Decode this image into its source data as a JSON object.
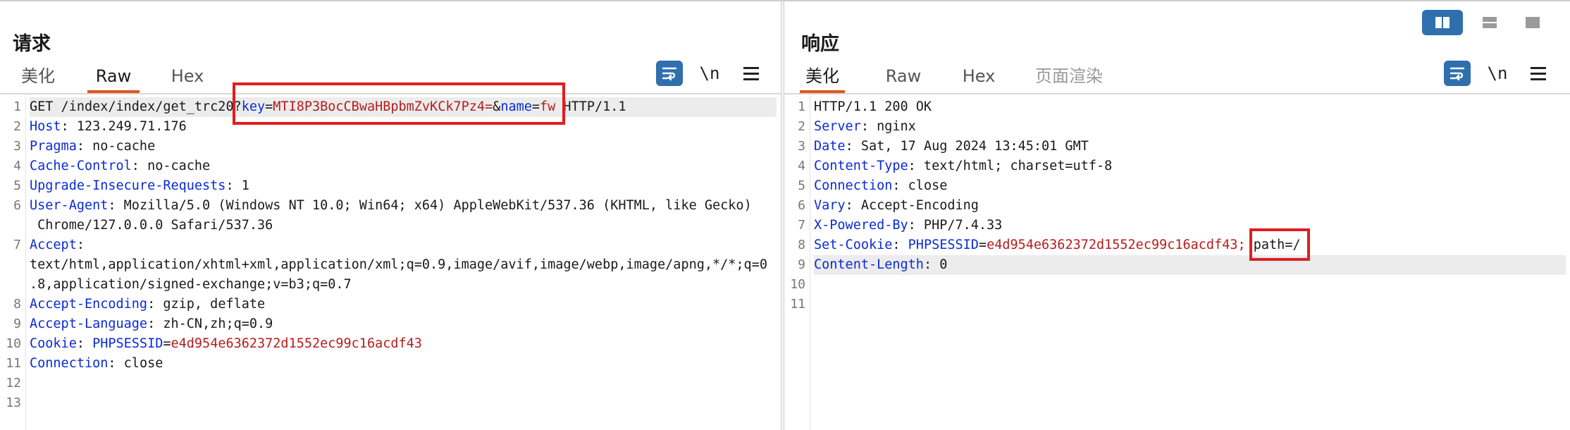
{
  "request": {
    "title": "请求",
    "tabs": [
      {
        "label": "美化",
        "active": false
      },
      {
        "label": "Raw",
        "active": true
      },
      {
        "label": "Hex",
        "active": false
      }
    ],
    "toolbar": {
      "wrap_icon": "wrap-lines-icon",
      "newline_label": "\\n",
      "menu_icon": "hamburger-menu-icon"
    },
    "lines": [
      {
        "n": "1",
        "segments": [
          {
            "t": "GET /index/index/get_trc20?"
          },
          {
            "t": "key",
            "c": "k"
          },
          {
            "t": "="
          },
          {
            "t": "MTI8P3BocCBwaHBpbmZvKCk7Pz4=",
            "c": "v"
          },
          {
            "t": "&"
          },
          {
            "t": "name",
            "c": "k"
          },
          {
            "t": "="
          },
          {
            "t": "fw",
            "c": "v"
          },
          {
            "t": " HTTP/1.1"
          }
        ]
      },
      {
        "n": "2",
        "segments": [
          {
            "t": "Host",
            "c": "k"
          },
          {
            "t": ": 123.249.71.176"
          }
        ]
      },
      {
        "n": "3",
        "segments": [
          {
            "t": "Pragma",
            "c": "k"
          },
          {
            "t": ": no-cache"
          }
        ]
      },
      {
        "n": "4",
        "segments": [
          {
            "t": "Cache-Control",
            "c": "k"
          },
          {
            "t": ": no-cache"
          }
        ]
      },
      {
        "n": "5",
        "segments": [
          {
            "t": "Upgrade-Insecure-Requests",
            "c": "k"
          },
          {
            "t": ": 1"
          }
        ]
      },
      {
        "n": "6",
        "segments": [
          {
            "t": "User-Agent",
            "c": "k"
          },
          {
            "t": ": Mozilla/5.0 (Windows NT 10.0; Win64; x64) AppleWebKit/537.36 (KHTML, like Gecko)"
          }
        ]
      },
      {
        "n": "",
        "segments": [
          {
            "t": " Chrome/127.0.0.0 Safari/537.36"
          }
        ]
      },
      {
        "n": "7",
        "segments": [
          {
            "t": "Accept",
            "c": "k"
          },
          {
            "t": ":"
          }
        ]
      },
      {
        "n": "",
        "segments": [
          {
            "t": "text/html,application/xhtml+xml,application/xml;q=0.9,image/avif,image/webp,image/apng,*/*;q=0"
          }
        ]
      },
      {
        "n": "",
        "segments": [
          {
            "t": ".8,application/signed-exchange;v=b3;q=0.7"
          }
        ]
      },
      {
        "n": "8",
        "segments": [
          {
            "t": "Accept-Encoding",
            "c": "k"
          },
          {
            "t": ": gzip, deflate"
          }
        ]
      },
      {
        "n": "9",
        "segments": [
          {
            "t": "Accept-Language",
            "c": "k"
          },
          {
            "t": ": zh-CN,zh;q=0.9"
          }
        ]
      },
      {
        "n": "10",
        "segments": [
          {
            "t": "Cookie",
            "c": "k"
          },
          {
            "t": ": "
          },
          {
            "t": "PHPSESSID",
            "c": "k"
          },
          {
            "t": "="
          },
          {
            "t": "e4d954e6362372d1552ec99c16acdf43",
            "c": "v"
          }
        ]
      },
      {
        "n": "11",
        "segments": [
          {
            "t": "Connection",
            "c": "k"
          },
          {
            "t": ": close"
          }
        ]
      },
      {
        "n": "12",
        "segments": []
      },
      {
        "n": "13",
        "segments": []
      }
    ]
  },
  "response": {
    "title": "响应",
    "tabs": [
      {
        "label": "美化",
        "active": true
      },
      {
        "label": "Raw",
        "active": false
      },
      {
        "label": "Hex",
        "active": false
      },
      {
        "label": "页面渲染",
        "active": false,
        "dim": true
      }
    ],
    "toolbar": {
      "wrap_icon": "wrap-lines-icon",
      "newline_label": "\\n",
      "menu_icon": "hamburger-menu-icon"
    },
    "lines": [
      {
        "n": "1",
        "segments": [
          {
            "t": "HTTP/1.1 200 OK"
          }
        ]
      },
      {
        "n": "2",
        "segments": [
          {
            "t": "Server",
            "c": "k"
          },
          {
            "t": ": nginx"
          }
        ]
      },
      {
        "n": "3",
        "segments": [
          {
            "t": "Date",
            "c": "k"
          },
          {
            "t": ": Sat, 17 Aug 2024 13:45:01 GMT"
          }
        ]
      },
      {
        "n": "4",
        "segments": [
          {
            "t": "Content-Type",
            "c": "k"
          },
          {
            "t": ": text/html; charset=utf-8"
          }
        ]
      },
      {
        "n": "5",
        "segments": [
          {
            "t": "Connection",
            "c": "k"
          },
          {
            "t": ": close"
          }
        ]
      },
      {
        "n": "6",
        "segments": [
          {
            "t": "Vary",
            "c": "k"
          },
          {
            "t": ": Accept-Encoding"
          }
        ]
      },
      {
        "n": "7",
        "segments": [
          {
            "t": "X-Powered-By",
            "c": "k"
          },
          {
            "t": ": PHP/7.4.33"
          }
        ]
      },
      {
        "n": "8",
        "segments": [
          {
            "t": "Set-Cookie",
            "c": "k"
          },
          {
            "t": ": "
          },
          {
            "t": "PHPSESSID",
            "c": "k"
          },
          {
            "t": "="
          },
          {
            "t": "e4d954e6362372d1552ec99c16acdf43;",
            "c": "v"
          },
          {
            "t": " path=/"
          }
        ]
      },
      {
        "n": "9",
        "segments": [
          {
            "t": "Content-Length",
            "c": "k"
          },
          {
            "t": ": 0"
          }
        ]
      },
      {
        "n": "10",
        "segments": []
      },
      {
        "n": "11",
        "segments": []
      }
    ]
  },
  "view_switch": {
    "icons": [
      "split-horizontal-icon",
      "split-vertical-icon",
      "single-pane-icon"
    ],
    "active": 0
  },
  "colors": {
    "accent": "#2f6fae",
    "tab_underline": "#e0561d",
    "key": "#0b2bd6",
    "value": "#b51d1d",
    "highlight_box": "#e01e1e"
  }
}
